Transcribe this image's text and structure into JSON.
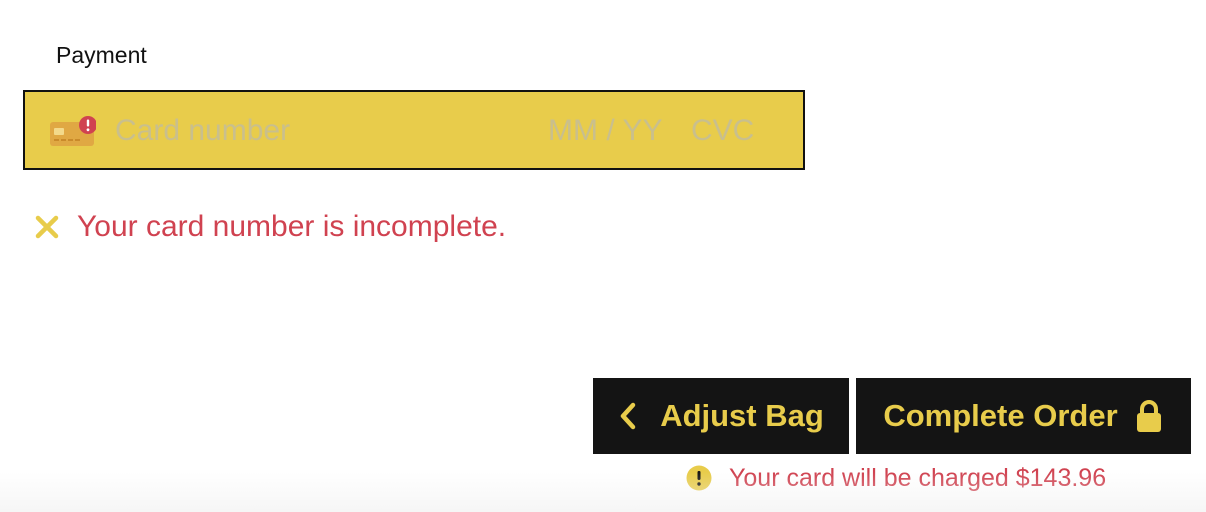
{
  "payment": {
    "label": "Payment",
    "card_number_placeholder": "Card number",
    "card_number_value": "",
    "expiry_placeholder": "MM / YY",
    "expiry_value": "",
    "cvc_placeholder": "CVC",
    "cvc_value": "",
    "card_icon": "credit-card-error-icon",
    "error_icon": "close-x-icon",
    "error_message": "Your card number is incomplete."
  },
  "actions": {
    "adjust_bag_label": "Adjust Bag",
    "adjust_bag_icon": "chevron-left-icon",
    "complete_order_label": "Complete Order",
    "complete_order_icon": "lock-icon"
  },
  "notice": {
    "icon": "info-exclamation-icon",
    "charge_text": "Your card will be charged $143.96"
  },
  "colors": {
    "accent_yellow": "#e8cc4b",
    "button_black": "#141414",
    "error_red": "#d04250",
    "field_border": "#111111"
  }
}
